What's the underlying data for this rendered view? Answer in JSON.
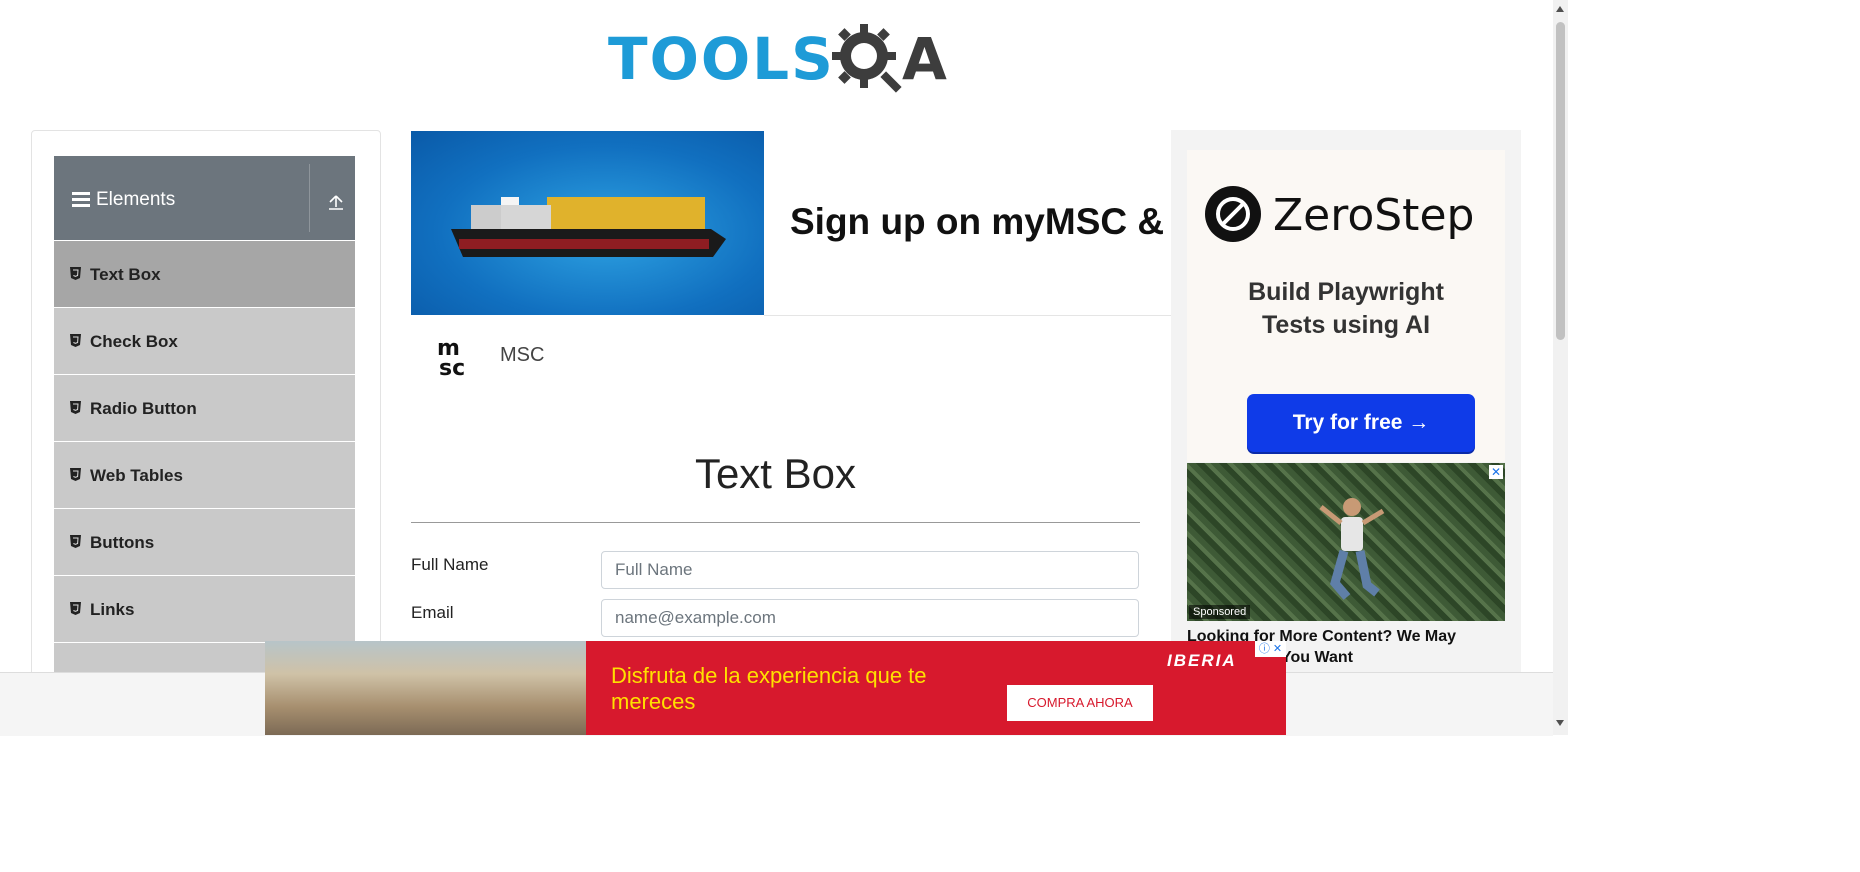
{
  "brand": {
    "logo_text": "TOOLS",
    "logo_q": "Q",
    "logo_a": "A"
  },
  "sidebar": {
    "group_title": "Elements",
    "items": [
      {
        "label": "Text Box",
        "active": true
      },
      {
        "label": "Check Box"
      },
      {
        "label": "Radio Button"
      },
      {
        "label": "Web Tables"
      },
      {
        "label": "Buttons"
      },
      {
        "label": "Links"
      }
    ]
  },
  "msc_ad": {
    "headline": "Sign up on myMSC & B",
    "advertiser": "MSC"
  },
  "main": {
    "title": "Text Box",
    "full_name": {
      "label": "Full Name",
      "placeholder": "Full Name",
      "value": ""
    },
    "email": {
      "label": "Email",
      "placeholder": "name@example.com",
      "value": ""
    }
  },
  "right_ad": {
    "brand": "ZeroStep",
    "tagline_line1": "Build Playwright",
    "tagline_line2": "Tests using AI",
    "cta": "Try for free →",
    "sponsored_badge": "Sponsored",
    "sponsored_headline": "Looking for More Content? We May",
    "sponsored_headline2": "You Want",
    "close": "✕"
  },
  "bottom_ad": {
    "text": "Disfruta de la experiencia que te mereces",
    "cta": "COMPRA AHORA",
    "brand": "IBERIA",
    "adchoice": "ⓘ ✕"
  },
  "colors": {
    "brand_blue": "#1e9bd7",
    "sidebar_header": "#6c757d",
    "cta_blue": "#0f3be8",
    "iberia_red": "#d7192d"
  }
}
